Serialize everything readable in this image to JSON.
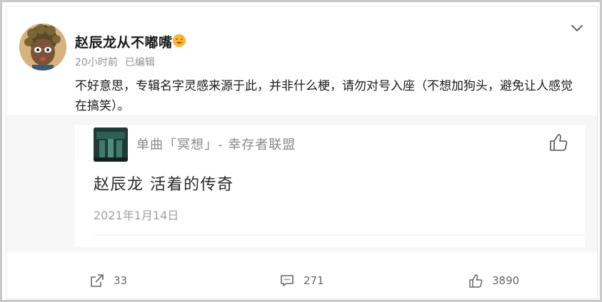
{
  "post": {
    "author": "赵辰龙从不嘟嘴",
    "time": "20小时前",
    "edited": "已编辑",
    "text": "不好意思，专辑名字灵感来源于此，并非什么梗，请勿对号入座（不想加狗头，避免让人感觉在搞笑）。"
  },
  "quote": {
    "title": "单曲「冥想」- 幸存者联盟",
    "body": "赵辰龙 活着的传奇",
    "date": "2021年1月14日"
  },
  "actions": {
    "share": "33",
    "comments": "271",
    "likes": "3890"
  },
  "icons": {
    "badge": "heart-eyes-emoji-icon",
    "more": "chevron-down-icon",
    "quote_like": "thumbs-up-icon",
    "share": "share-icon",
    "comment": "comment-icon",
    "like": "thumbs-up-icon"
  },
  "colors": {
    "username": "#1a1a1a",
    "meta": "#939393",
    "quote_title": "#8a8a8a",
    "action_text": "#666666"
  }
}
